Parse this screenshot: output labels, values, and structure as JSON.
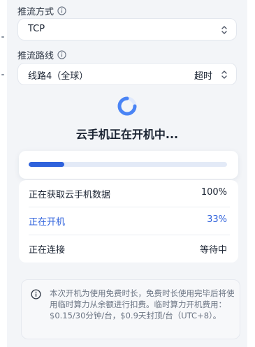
{
  "stream_mode": {
    "label": "推流方式",
    "value": "TCP"
  },
  "stream_route": {
    "label": "推流路线",
    "value": "线路4（全球）",
    "status": "超时"
  },
  "boot": {
    "title": "云手机正在开机中...",
    "progress_fraction": 0.18
  },
  "steps": [
    {
      "label": "正在获取云手机数据",
      "status": "100%",
      "active": false
    },
    {
      "label": "正在开机",
      "status": "33%",
      "active": true
    },
    {
      "label": "正在连接",
      "status": "等待中",
      "active": false
    }
  ],
  "notice": {
    "text": "本次开机为使用免费时长，免费时长使用完毕后将使用临时算力从余额进行扣费。临时算力开机费用：$0.15/30分钟/台，$0.9天封顶/台（UTC+8）。"
  },
  "colors": {
    "accent": "#2f62dc",
    "spinner": "#4a84f5"
  },
  "icons": {
    "info": "info-circle-icon",
    "chevron": "chevron-up-down-icon",
    "spinner": "loading-spinner-icon"
  }
}
